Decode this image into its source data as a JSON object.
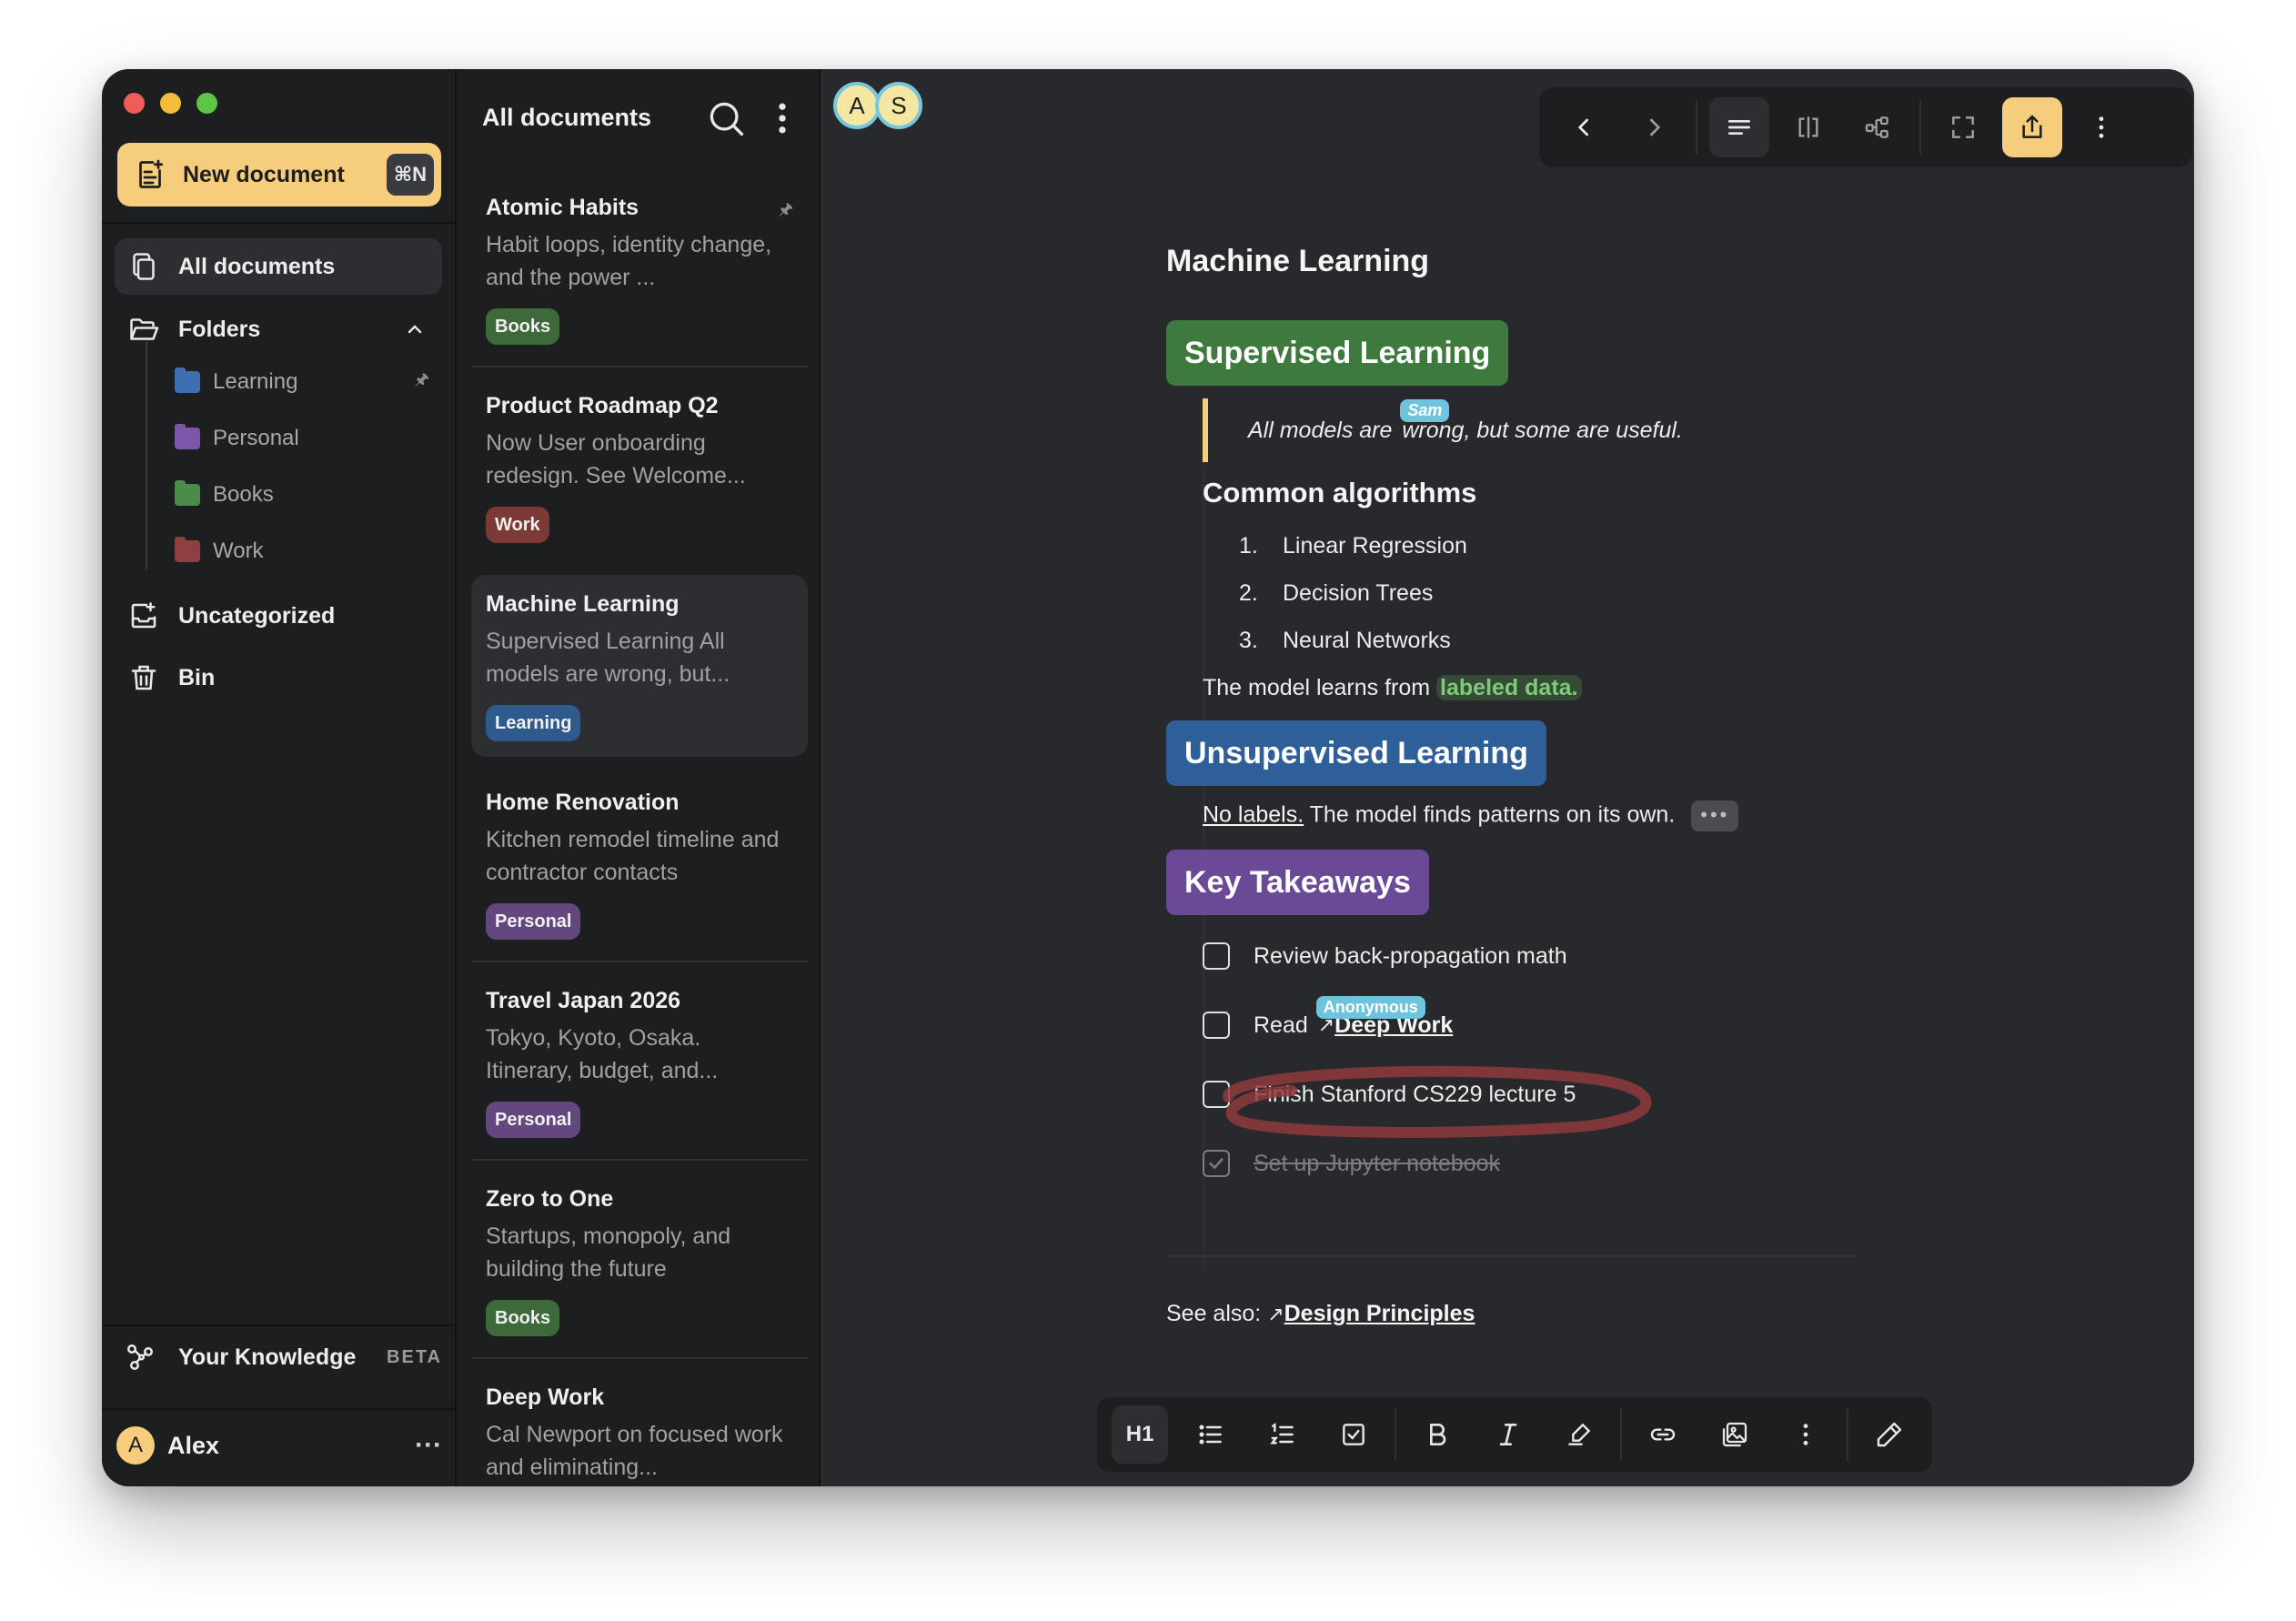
{
  "sidebar": {
    "new_document": "New document",
    "shortcut": "⌘N",
    "nav": {
      "all_documents": "All documents",
      "folders": "Folders",
      "uncategorized": "Uncategorized",
      "bin": "Bin"
    },
    "folders": [
      {
        "name": "Learning",
        "color": "#3f6fb0"
      },
      {
        "name": "Personal",
        "color": "#7c56a8"
      },
      {
        "name": "Books",
        "color": "#4c8c4a"
      },
      {
        "name": "Work",
        "color": "#8e3f3f"
      }
    ],
    "knowledge": "Your Knowledge",
    "beta": "BETA",
    "user": {
      "initial": "A",
      "name": "Alex"
    }
  },
  "doclist": {
    "title": "All documents",
    "documents": [
      {
        "title": "Atomic Habits",
        "desc": "Habit loops, identity change, and the power ...",
        "tag": "Books",
        "tag_color": "#3e6a3b"
      },
      {
        "title": "Product Roadmap Q2",
        "desc": "Now User onboarding redesign. See Welcome...",
        "tag": "Work",
        "tag_color": "#7b3a35"
      },
      {
        "title": "Machine Learning",
        "desc": "Supervised Learning All models are wrong, but...",
        "tag": "Learning",
        "tag_color": "#2f5a8e"
      },
      {
        "title": "Home Renovation",
        "desc": "Kitchen remodel timeline and contractor contacts",
        "tag": "Personal",
        "tag_color": "#64477f"
      },
      {
        "title": "Travel Japan 2026",
        "desc": "Tokyo, Kyoto, Osaka. Itinerary, budget, and...",
        "tag": "Personal",
        "tag_color": "#64477f"
      },
      {
        "title": "Zero to One",
        "desc": "Startups, monopoly, and building the future",
        "tag": "Books",
        "tag_color": "#3e6a3b"
      },
      {
        "title": "Deep Work",
        "desc": "Cal Newport on focused work and eliminating...",
        "tag": "",
        "tag_color": ""
      }
    ]
  },
  "editor": {
    "collaborators": [
      "A",
      "S"
    ],
    "title": "Machine Learning",
    "sections": {
      "supervised": "Supervised Learning",
      "unsupervised": "Unsupervised Learning",
      "takeaways": "Key Takeaways"
    },
    "quote_before": "All models are ",
    "quote_after": "wrong, but some are useful.",
    "cursor_sam": "Sam",
    "cursor_anon": "Anonymous",
    "algorithms_heading": "Common algorithms",
    "algorithms": [
      "Linear Regression",
      "Decision Trees",
      "Neural Networks"
    ],
    "model_learns": "The model learns from ",
    "labeled_data": "labeled data.",
    "no_labels": "No labels.",
    "unsup_text": " The model finds patterns on its own.",
    "ellipsis": "•••",
    "tasks": [
      {
        "label": "Review back-propagation math",
        "done": false
      },
      {
        "label": "Read ",
        "link": "Deep Work",
        "done": false
      },
      {
        "label": "Finish Stanford CS229 lecture 5",
        "done": false
      },
      {
        "label": "Set up Jupyter notebook",
        "done": true
      }
    ],
    "see_also": "See also: ",
    "see_also_link": "Design Principles",
    "h1_label": "H1"
  },
  "colors": {
    "supervised": "#3e7a3e",
    "unsupervised": "#2f5f98",
    "takeaways": "#6a4a96",
    "accent": "#f5cd7c"
  }
}
